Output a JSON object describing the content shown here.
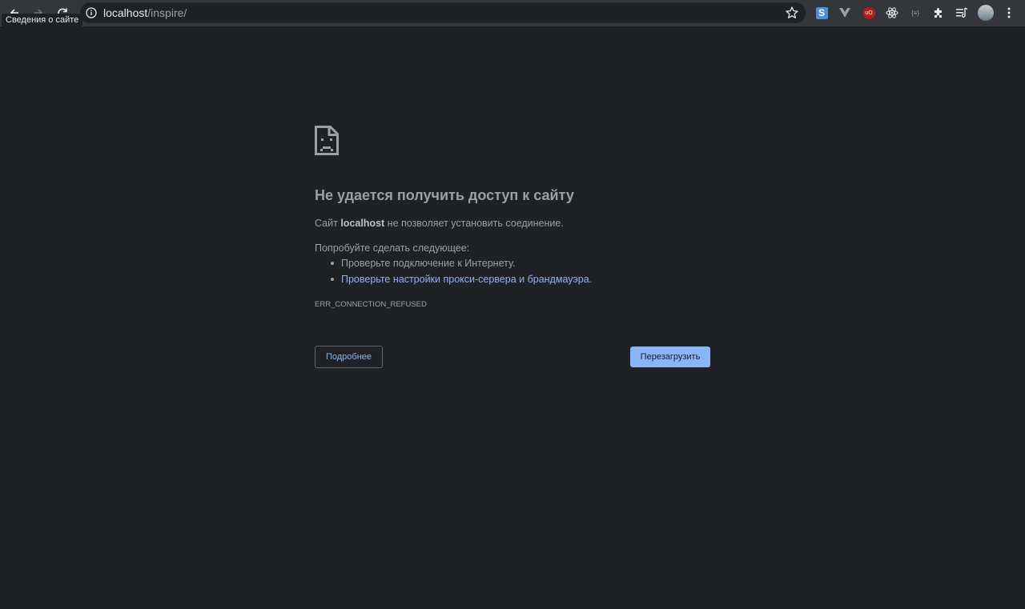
{
  "browser": {
    "url_host": "localhost",
    "url_path": "/inspire/",
    "tooltip": "Сведения о сайте",
    "nav_icons": [
      "back-icon",
      "forward-icon",
      "reload-icon"
    ],
    "extensions": [
      {
        "name": "s-extension-icon",
        "label": "S",
        "color": "#4a90d9"
      },
      {
        "name": "vue-devtools-icon",
        "label": "V",
        "color": "#9aa0a6"
      },
      {
        "name": "ublock-origin-icon",
        "label": "uO",
        "color": "#b71c1c"
      },
      {
        "name": "react-devtools-icon",
        "label": "⚛",
        "color": "#e8eaed"
      },
      {
        "name": "json-viewer-icon",
        "label": "{≡}",
        "color": "#9aa0a6"
      },
      {
        "name": "extensions-puzzle-icon",
        "label": "",
        "color": "#e8eaed"
      },
      {
        "name": "reading-list-icon",
        "label": "",
        "color": "#e8eaed"
      }
    ]
  },
  "error_page": {
    "title": "Не удается получить доступ к сайту",
    "desc_prefix": "Сайт ",
    "desc_host": "localhost",
    "desc_suffix": " не позволяет установить соединение.",
    "suggest_heading": "Попробуйте сделать следующее:",
    "suggestions": [
      {
        "text": "Проверьте подключение к Интернету.",
        "link": false
      },
      {
        "text": "Проверьте настройки прокси-сервера и брандмауэра",
        "link": true,
        "trail": "."
      }
    ],
    "error_code": "ERR_CONNECTION_REFUSED",
    "details_button": "Подробнее",
    "reload_button": "Перезагрузить"
  },
  "colors": {
    "page_bg": "#202124",
    "toolbar_bg": "#35363a",
    "text_secondary": "#9aa0a6",
    "link": "#8ab4f8",
    "primary_button": "#8ab4f8"
  }
}
